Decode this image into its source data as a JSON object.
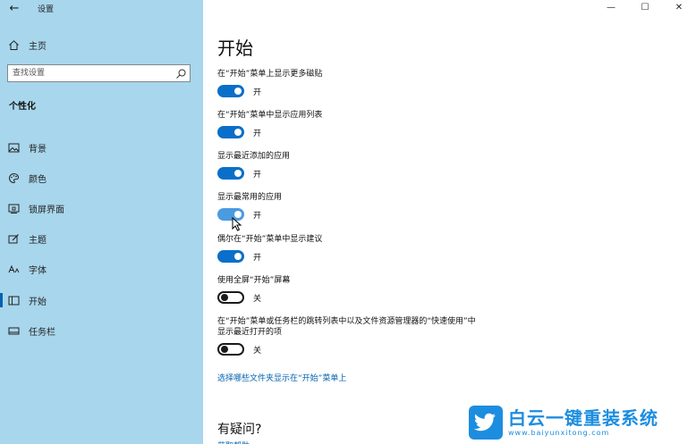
{
  "app": {
    "title": "设置",
    "back_glyph": "←"
  },
  "window_controls": {
    "minimize": "—",
    "maximize": "☐",
    "close": "✕"
  },
  "sidebar": {
    "home_label": "主页",
    "search_placeholder": "查找设置",
    "section_title": "个性化",
    "items": [
      {
        "label": "背景",
        "icon": "picture-icon"
      },
      {
        "label": "颜色",
        "icon": "palette-icon"
      },
      {
        "label": "锁屏界面",
        "icon": "lockscreen-icon"
      },
      {
        "label": "主题",
        "icon": "theme-icon"
      },
      {
        "label": "字体",
        "icon": "font-icon"
      },
      {
        "label": "开始",
        "icon": "start-icon",
        "selected": true
      },
      {
        "label": "任务栏",
        "icon": "taskbar-icon"
      }
    ]
  },
  "main": {
    "title": "开始",
    "settings": [
      {
        "label": "在“开始”菜单上显示更多磁贴",
        "state": "开"
      },
      {
        "label": "在“开始”菜单中显示应用列表",
        "state": "开"
      },
      {
        "label": "显示最近添加的应用",
        "state": "开"
      },
      {
        "label": "显示最常用的应用",
        "state": "开"
      },
      {
        "label": "偶尔在“开始”菜单中显示建议",
        "state": "开"
      },
      {
        "label": "使用全屏“开始”屏幕",
        "state": "关"
      },
      {
        "label_line1": "在“开始”菜单或任务栏的跳转列表中以及文件资源管理器的“快速使用”中",
        "label_line2": "显示最近打开的项",
        "state": "关"
      }
    ],
    "folders_link": "选择哪些文件夹显示在“开始”菜单上",
    "question_heading": "有疑问?",
    "question_link": "获取帮助"
  },
  "watermark": {
    "title": "白云一键重装系统",
    "url": "www.baiyunxitong.com"
  },
  "colors": {
    "sidebar_bg": "#a8d6ec",
    "accent": "#0a6fc9",
    "link": "#0063b1"
  }
}
